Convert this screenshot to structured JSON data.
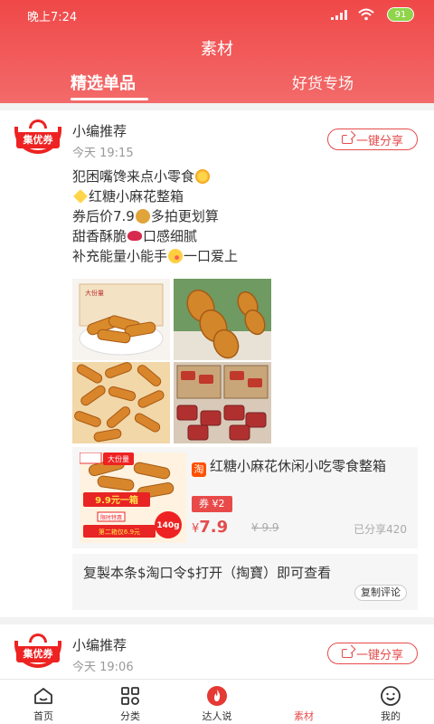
{
  "status_bar": {
    "time": "晚上7:24",
    "battery": "91"
  },
  "header": {
    "title": "素材"
  },
  "tabs": [
    {
      "label": "精选单品",
      "active": true
    },
    {
      "label": "好货专场",
      "active": false
    }
  ],
  "posts": [
    {
      "logo_text": "集优券",
      "author": "小编推荐",
      "time": "今天 19:15",
      "share_label": "一键分享",
      "lines": [
        "犯困嘴馋来点小零食",
        "红糖小麻花整箱",
        "券后价7.9",
        "多拍更划算",
        "甜香酥脆",
        "口感细腻",
        "补充能量小能手",
        "一口爱上"
      ],
      "product": {
        "platform_icon": "淘",
        "title": "红糖小麻花休闲小吃零食整箱",
        "coupon": "券 ¥2",
        "currency": "¥",
        "price": "7.9",
        "original_price": "¥ 9.9",
        "shared_count": "已分享420",
        "image_text": {
          "corner_tag": "大份量",
          "price_banner": "9.9元一箱",
          "weight_badge": "140g",
          "promo_line1": "限时特惠",
          "promo_line2": "第二箱仅6.9元"
        }
      },
      "copy_text": "复製本条$淘口令$打开（掏寶）即可查看",
      "copy_button": "复制评论"
    },
    {
      "logo_text": "集优券",
      "author": "小编推荐",
      "time": "今天 19:06",
      "share_label": "一键分享"
    }
  ],
  "bottom_nav": [
    {
      "label": "首页",
      "icon": "home-icon"
    },
    {
      "label": "分类",
      "icon": "category-icon"
    },
    {
      "label": "达人说",
      "icon": "fire-icon"
    },
    {
      "label": "素材",
      "icon": "material-icon",
      "active": true
    },
    {
      "label": "我的",
      "icon": "profile-icon"
    }
  ],
  "colors": {
    "accent": "#e54b4b",
    "header": "#f04848"
  }
}
